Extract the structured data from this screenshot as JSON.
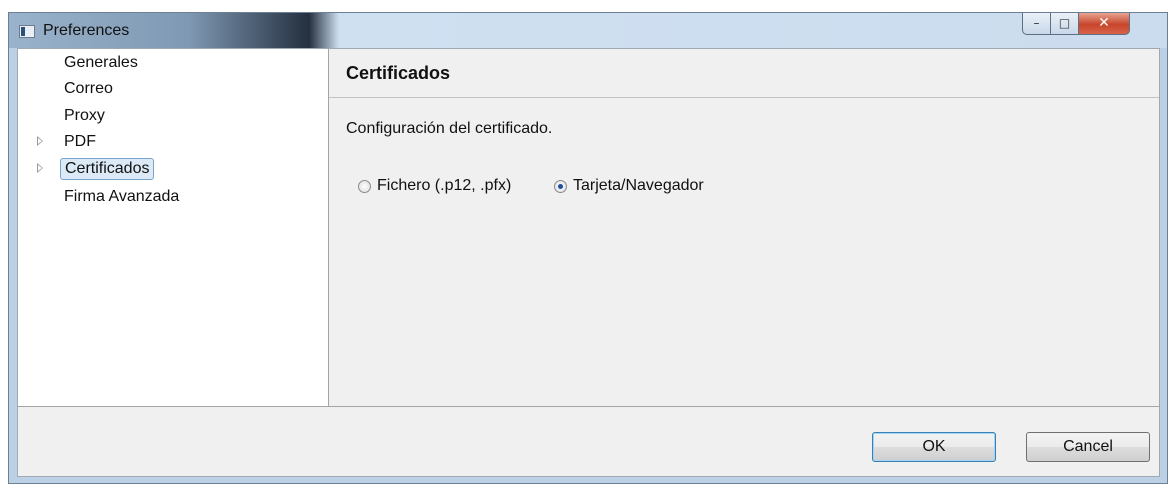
{
  "window": {
    "title": "Preferences",
    "controls": {
      "minimize": "–",
      "maximize": "□",
      "close": "✕"
    }
  },
  "sidebar": {
    "items": [
      {
        "label": "Generales",
        "expandable": false,
        "selected": false
      },
      {
        "label": "Correo",
        "expandable": false,
        "selected": false
      },
      {
        "label": "Proxy",
        "expandable": false,
        "selected": false
      },
      {
        "label": "PDF",
        "expandable": true,
        "selected": false
      },
      {
        "label": "Certificados",
        "expandable": true,
        "selected": true
      },
      {
        "label": "Firma Avanzada",
        "expandable": false,
        "selected": false
      }
    ]
  },
  "panel": {
    "title": "Certificados",
    "description": "Configuración del certificado.",
    "options": [
      {
        "label": "Fichero (.p12, .pfx)",
        "checked": false
      },
      {
        "label": "Tarjeta/Navegador",
        "checked": true
      }
    ]
  },
  "buttons": {
    "ok": "OK",
    "cancel": "Cancel"
  },
  "colors": {
    "selection": "#dceaf7",
    "close_button": "#c7452b",
    "radio_dot": "#1d4f9e"
  }
}
